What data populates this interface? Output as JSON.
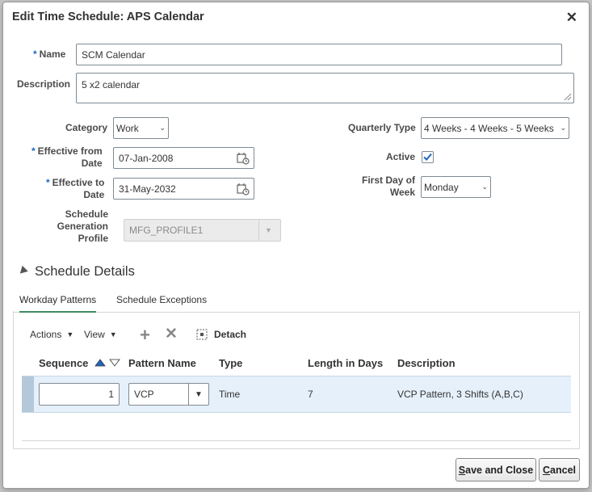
{
  "dialog": {
    "title": "Edit Time Schedule: APS Calendar",
    "close_icon": "close-icon"
  },
  "form": {
    "required_marker": "*",
    "name_label": "Name",
    "name_value": "SCM Calendar",
    "description_label": "Description",
    "description_value": "5 x2 calendar",
    "category_label": "Category",
    "category_value": "Work",
    "effective_from_label_1": "Effective from",
    "effective_from_label_2": "Date",
    "effective_from_value": "07-Jan-2008",
    "effective_to_label_1": "Effective to",
    "effective_to_label_2": "Date",
    "effective_to_value": "31-May-2032",
    "profile_label_1": "Schedule",
    "profile_label_2": "Generation",
    "profile_label_3": "Profile",
    "profile_value": "MFG_PROFILE1",
    "quarterly_type_label": "Quarterly Type",
    "quarterly_type_value": "4 Weeks - 4 Weeks - 5 Weeks",
    "active_label": "Active",
    "active_checked": true,
    "first_day_label_1": "First Day of",
    "first_day_label_2": "Week",
    "first_day_value": "Monday"
  },
  "section": {
    "title": "Schedule Details"
  },
  "tabs": [
    {
      "label": "Workday Patterns",
      "active": true
    },
    {
      "label": "Schedule Exceptions",
      "active": false
    }
  ],
  "toolbar": {
    "actions_label": "Actions",
    "view_label": "View",
    "detach_label": "Detach"
  },
  "table": {
    "headers": [
      "Sequence",
      "Pattern Name",
      "Type",
      "Length in Days",
      "Description"
    ],
    "rows": [
      {
        "sequence": "1",
        "pattern_name": "VCP",
        "type": "Time",
        "length": "7",
        "description": "VCP Pattern, 3 Shifts (A,B,C)"
      }
    ]
  },
  "buttons": {
    "save_close_first": "S",
    "save_close_rest": "ave and Close",
    "cancel_first": "C",
    "cancel_rest": "ancel"
  },
  "colors": {
    "accent": "#1f66c2",
    "tab_active": "#3f8a62",
    "row_selected": "#e5f0fa"
  }
}
